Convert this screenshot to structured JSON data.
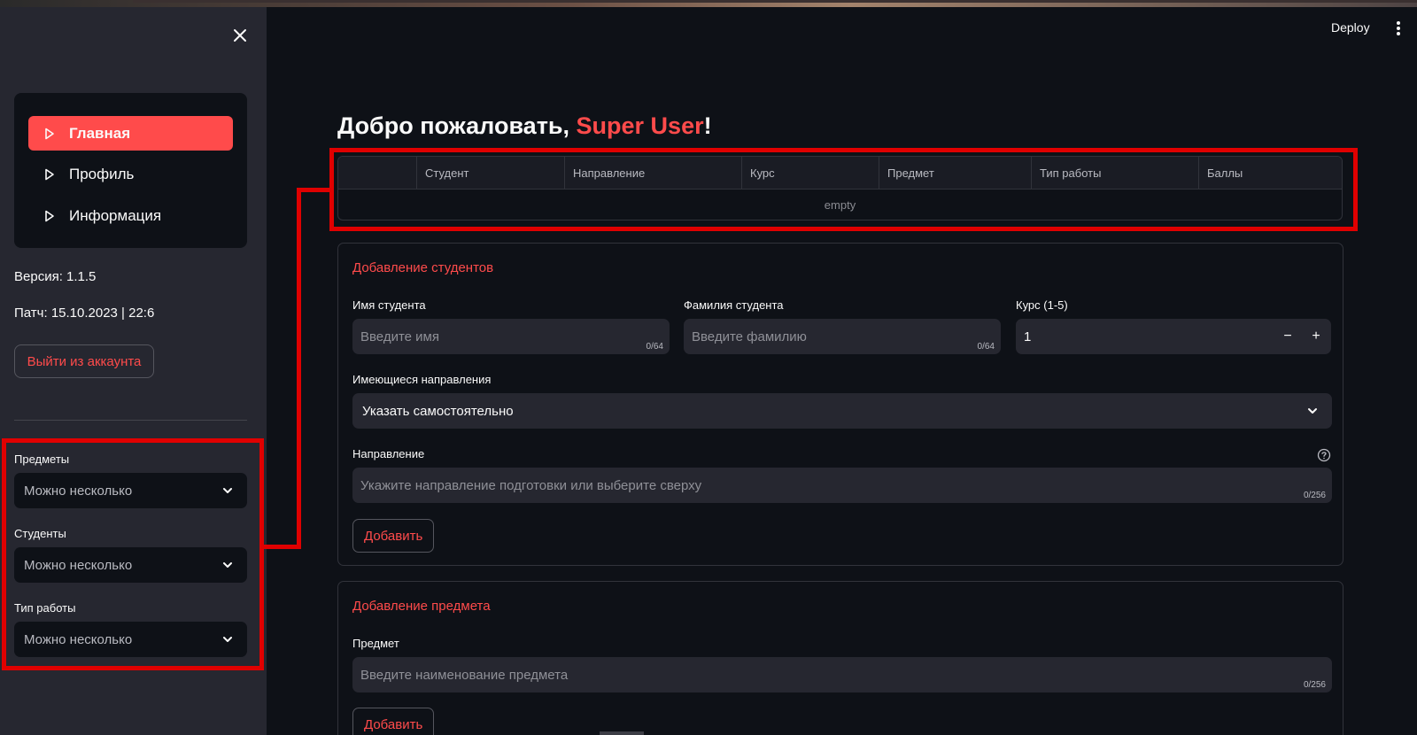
{
  "sidebar": {
    "nav": [
      {
        "label": "Главная",
        "active": true
      },
      {
        "label": "Профиль",
        "active": false
      },
      {
        "label": "Информация",
        "active": false
      }
    ],
    "version": "Версия: 1.1.5",
    "patch": "Патч: 15.10.2023 | 22:6",
    "logout_label": "Выйти из аккаунта",
    "filters": [
      {
        "label": "Предметы",
        "placeholder": "Можно несколько"
      },
      {
        "label": "Студенты",
        "placeholder": "Можно несколько"
      },
      {
        "label": "Тип работы",
        "placeholder": "Можно несколько"
      }
    ]
  },
  "header": {
    "deploy_label": "Deploy"
  },
  "main": {
    "title_prefix": "Добро пожаловать, ",
    "title_user": "Super User",
    "title_suffix": "!",
    "table": {
      "columns": [
        "",
        "Студент",
        "Направление",
        "Курс",
        "Предмет",
        "Тип работы",
        "Баллы"
      ],
      "empty_text": "empty"
    },
    "add_student": {
      "title": "Добавление студентов",
      "first_name_label": "Имя студента",
      "first_name_placeholder": "Введите имя",
      "first_name_count": "0/64",
      "last_name_label": "Фамилия студента",
      "last_name_placeholder": "Введите фамилию",
      "last_name_count": "0/64",
      "course_label": "Курс (1-5)",
      "course_value": "1",
      "minus": "−",
      "plus": "+",
      "directions_label": "Имеющиеся направления",
      "directions_value": "Указать самостоятельно",
      "direction_label": "Направление",
      "direction_placeholder": "Укажите направление подготовки или выберите сверху",
      "direction_count": "0/256",
      "add_label": "Добавить"
    },
    "add_subject": {
      "title": "Добавление предмета",
      "subject_label": "Предмет",
      "subject_placeholder": "Введите наименование предмета",
      "subject_count": "0/256",
      "add_label": "Добавить"
    }
  },
  "colors": {
    "accent": "#ff4b4b",
    "annotation": "#e00000",
    "background": "#0e1117",
    "sidebar": "#262730"
  }
}
